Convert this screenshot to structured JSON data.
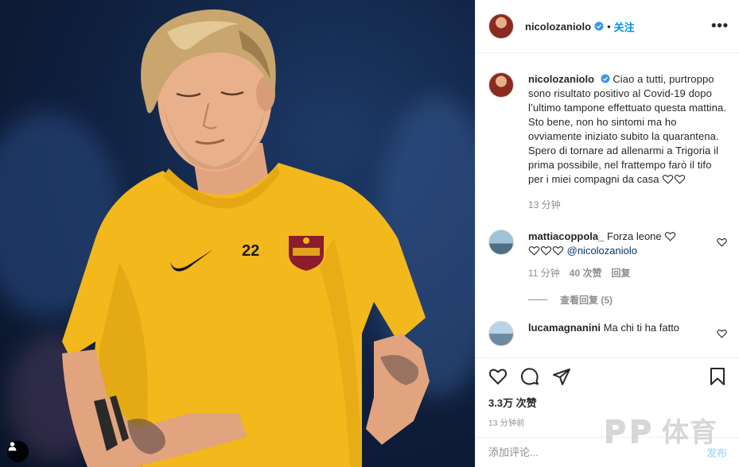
{
  "post": {
    "username": "nicolozaniolo",
    "follow_label": "关注",
    "more_label": "•••",
    "caption": "Ciao a tutti, purtroppo sono risultato positivo al Covid-19 dopo l’ultimo tampone effettuato questa mattina. Sto bene, non ho sintomi ma ho ovviamente iniziato subito la quarantena. Spero di tornare ad allenarmi a Trigoria il prima possibile, nel frattempo farò il tifo per i miei compagni da casa",
    "caption_time": "13 分钟"
  },
  "comments": [
    {
      "username": "mattiacoppola_",
      "text": "Forza leone",
      "mention": "@nicolozaniolo",
      "time": "11 分钟",
      "likes": "40 次赞",
      "reply_label": "回复",
      "view_replies": "查看回复 (5)"
    },
    {
      "username": "lucamagnanini",
      "text": "Ma chi ti ha fatto"
    }
  ],
  "actions": {
    "likes_count": "3.3万 次赞",
    "timestamp": "13 分钟前"
  },
  "add_comment": {
    "placeholder": "添加评论...",
    "post_label": "发布"
  },
  "watermark": {
    "logo": "PP",
    "text": "体育"
  },
  "colors": {
    "accent": "#0095f6",
    "jersey": "#f2b81c",
    "text": "#262626",
    "muted": "#8e8e8e"
  }
}
